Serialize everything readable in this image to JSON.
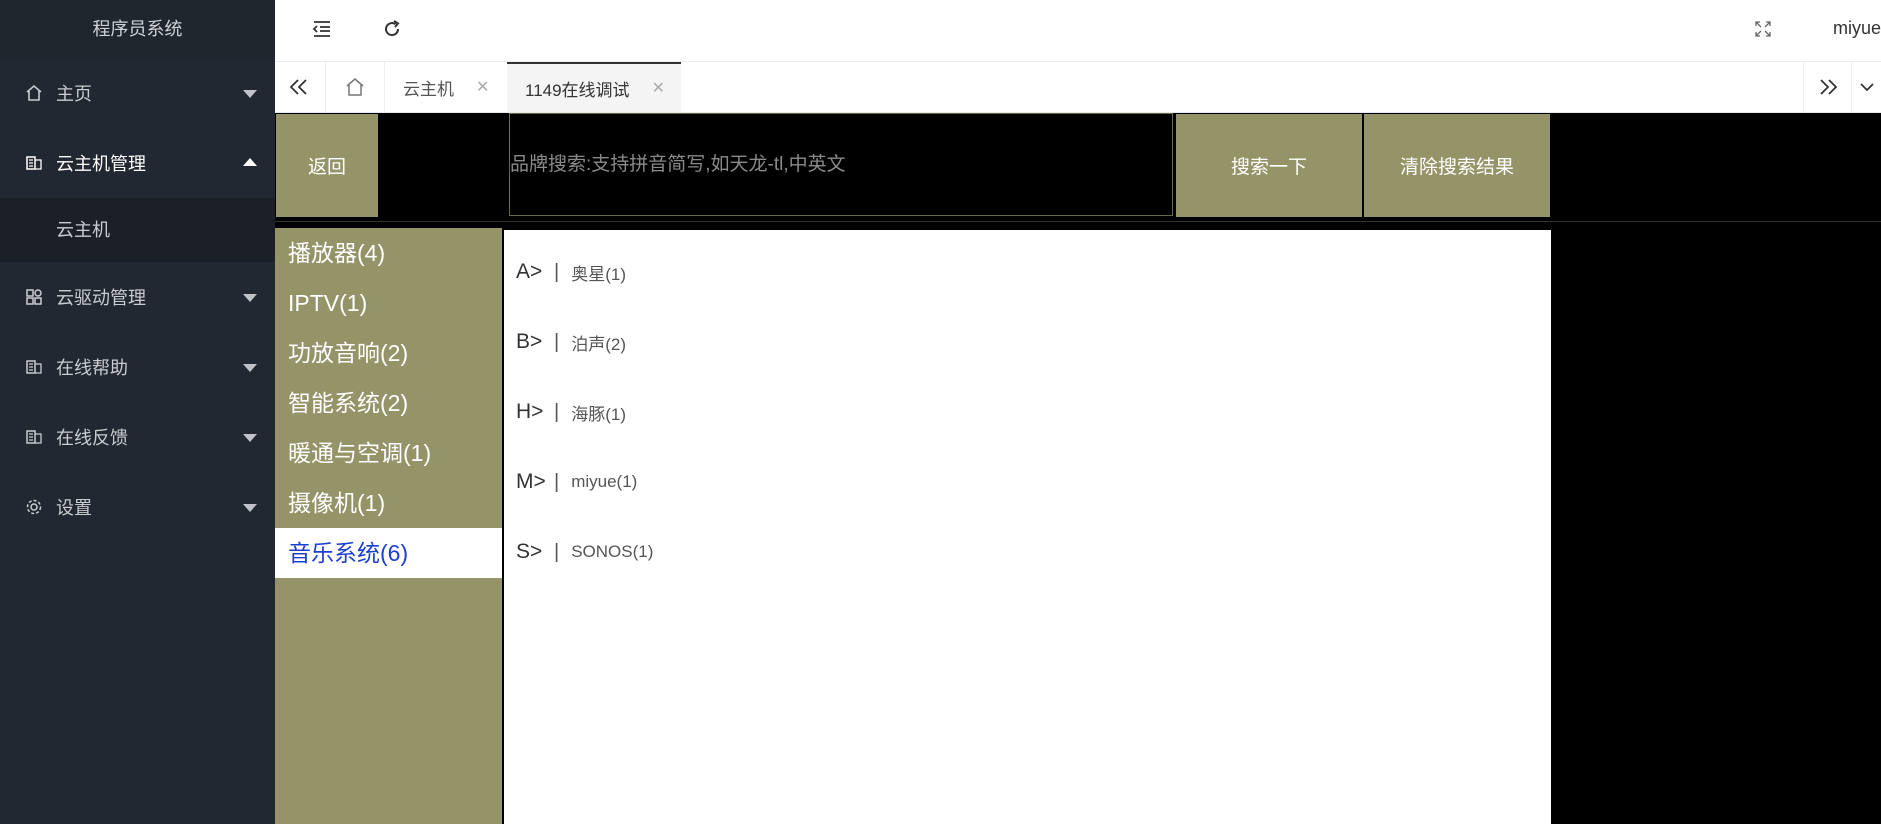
{
  "app": {
    "title": "程序员系统"
  },
  "sidebar": {
    "items": [
      {
        "label": "主页",
        "icon": "home-icon",
        "expanded": false
      },
      {
        "label": "云主机管理",
        "icon": "server-icon",
        "expanded": true,
        "children": [
          "云主机"
        ]
      },
      {
        "label": "云驱动管理",
        "icon": "apps-icon",
        "expanded": false
      },
      {
        "label": "在线帮助",
        "icon": "server-icon",
        "expanded": false
      },
      {
        "label": "在线反馈",
        "icon": "server-icon",
        "expanded": false
      },
      {
        "label": "设置",
        "icon": "gear-icon",
        "expanded": false
      }
    ]
  },
  "header": {
    "user": "miyue"
  },
  "tabs": [
    {
      "label": "云主机",
      "active": false
    },
    {
      "label": "1149在线调试",
      "active": true
    }
  ],
  "toolbar": {
    "back_label": "返回",
    "search_placeholder": "品牌搜索:支持拼音简写,如天龙-tl,中英文",
    "search_value": "",
    "search_label": "搜索一下",
    "clear_label": "清除搜索结果"
  },
  "categories": [
    {
      "label": "播放器(4)",
      "selected": false
    },
    {
      "label": "IPTV(1)",
      "selected": false
    },
    {
      "label": "功放音响(2)",
      "selected": false
    },
    {
      "label": "智能系统(2)",
      "selected": false
    },
    {
      "label": "暖通与空调(1)",
      "selected": false
    },
    {
      "label": "摄像机(1)",
      "selected": false
    },
    {
      "label": "音乐系统(6)",
      "selected": true
    }
  ],
  "brands": [
    {
      "letter": "A>",
      "name": "奥星(1)"
    },
    {
      "letter": "B>",
      "name": "泊声(2)"
    },
    {
      "letter": "H>",
      "name": "海豚(1)"
    },
    {
      "letter": "M>",
      "name": "miyue(1)"
    },
    {
      "letter": "S>",
      "name": "SONOS(1)"
    }
  ],
  "colors": {
    "accent": "#959469",
    "sidebar_bg": "#222831",
    "selected_text": "#1d3fd0"
  }
}
